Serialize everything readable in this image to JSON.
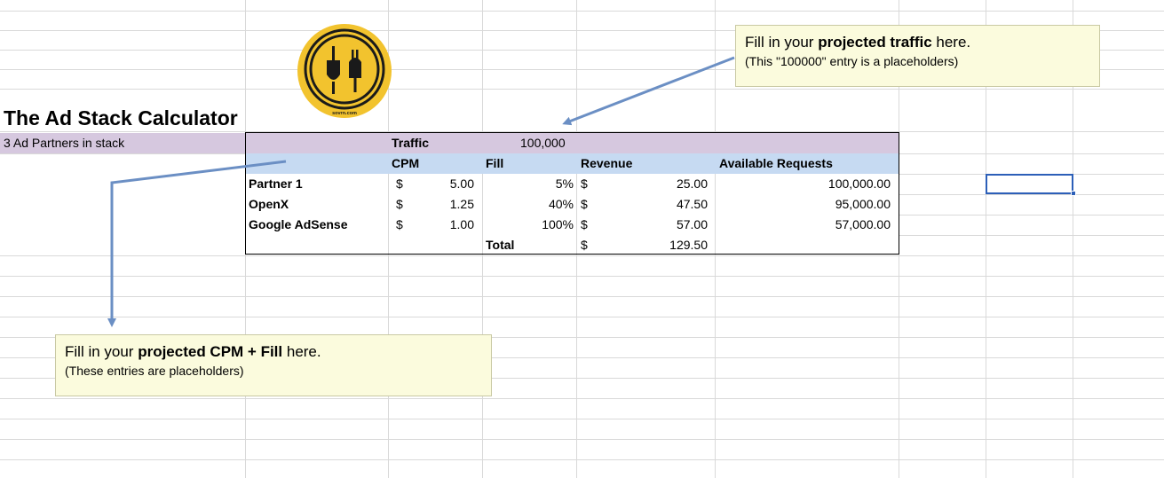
{
  "sheet": {
    "title": "The Ad Stack Calculator",
    "subtitle": "3 Ad Partners in stack",
    "traffic_label": "Traffic",
    "traffic_value": "100,000",
    "headers": {
      "cpm": "CPM",
      "fill": "Fill",
      "revenue": "Revenue",
      "available": "Available Requests"
    },
    "rows": [
      {
        "name": "Partner 1",
        "cpm_sym": "$",
        "cpm": "5.00",
        "fill": "5%",
        "rev_sym": "$",
        "revenue": "25.00",
        "available": "100,000.00"
      },
      {
        "name": "OpenX",
        "cpm_sym": "$",
        "cpm": "1.25",
        "fill": "40%",
        "rev_sym": "$",
        "revenue": "47.50",
        "available": "95,000.00"
      },
      {
        "name": "Google AdSense",
        "cpm_sym": "$",
        "cpm": "1.00",
        "fill": "100%",
        "rev_sym": "$",
        "revenue": "57.00",
        "available": "57,000.00"
      }
    ],
    "total": {
      "label": "Total",
      "sym": "$",
      "value": "129.50"
    }
  },
  "logo": {
    "text": "sovrn.com",
    "icon": "plug-icon",
    "color": "#f2c32e"
  },
  "notes": {
    "traffic": {
      "prefix": "Fill in your ",
      "bold": "projected traffic",
      "suffix": " here.",
      "sub": "(This \"100000\" entry is a placeholders)"
    },
    "cpm": {
      "prefix": "Fill in your ",
      "bold": "projected CPM + Fill",
      "suffix": " here.",
      "sub": "(These entries are placeholders)"
    }
  },
  "colors": {
    "title_band": "#d6c8df",
    "header_band": "#c6daf2",
    "note_bg": "#fbfbdd",
    "arrow": "#6b8fc4",
    "selection": "#2c5fb8"
  }
}
